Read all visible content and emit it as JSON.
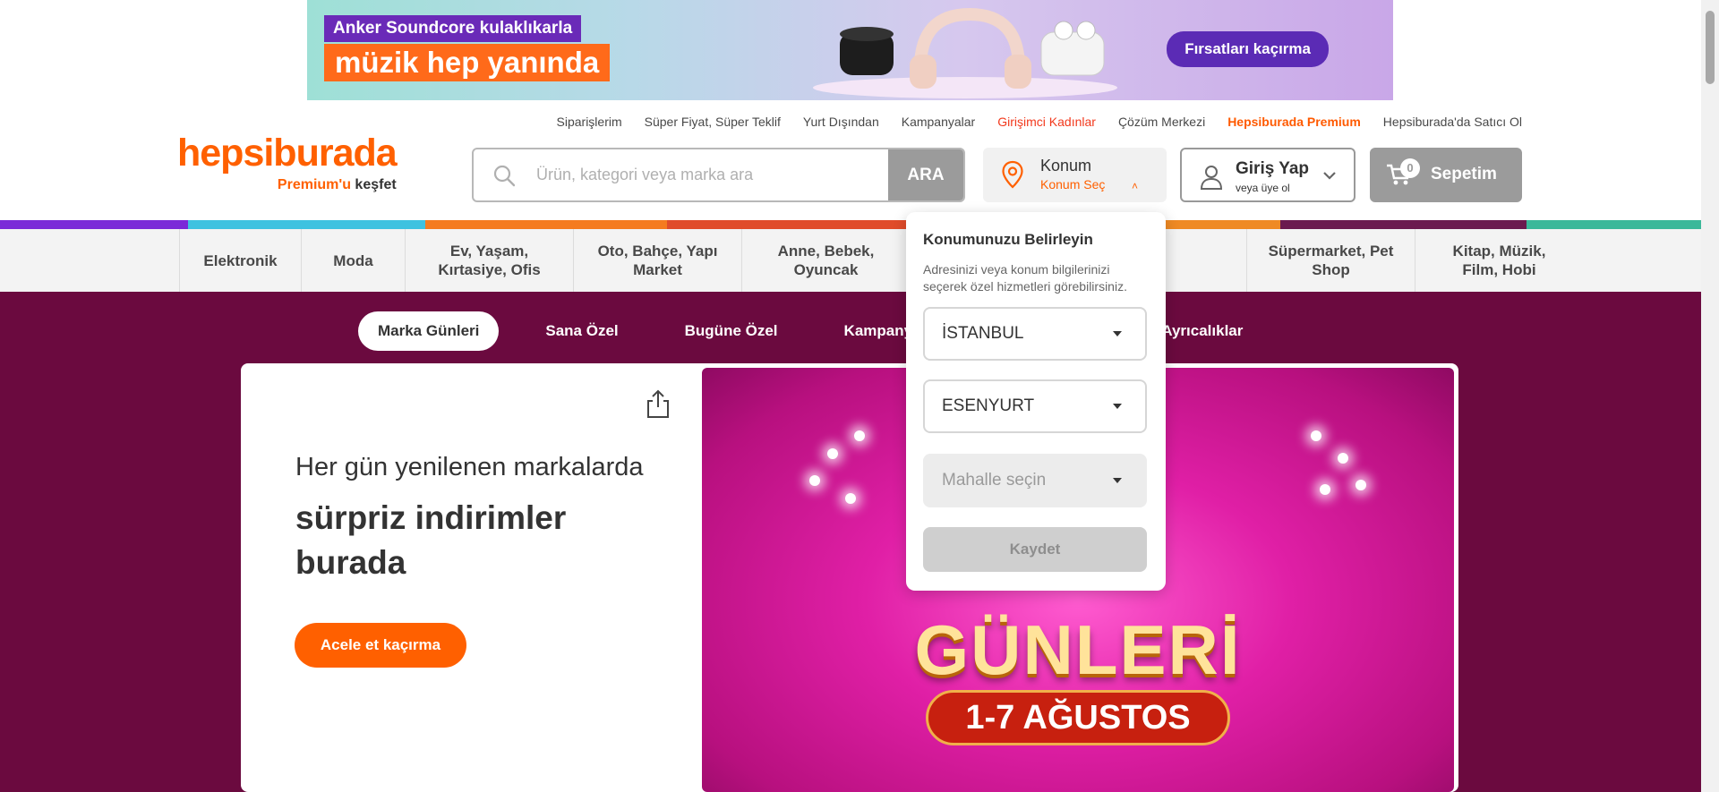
{
  "promo": {
    "line1": "Anker Soundcore kulaklıkarla",
    "line2": "müzik hep yanında",
    "cta": "Fırsatları kaçırma"
  },
  "utility_links": [
    {
      "label": "Siparişlerim",
      "style": "normal"
    },
    {
      "label": "Süper Fiyat, Süper Teklif",
      "style": "normal"
    },
    {
      "label": "Yurt Dışından",
      "style": "normal"
    },
    {
      "label": "Kampanyalar",
      "style": "normal"
    },
    {
      "label": "Girişimci Kadınlar",
      "style": "red"
    },
    {
      "label": "Çözüm Merkezi",
      "style": "normal"
    },
    {
      "label": "Hepsiburada Premium",
      "style": "orange"
    },
    {
      "label": "Hepsiburada'da Satıcı Ol",
      "style": "normal"
    }
  ],
  "logo": {
    "brand": "hepsiburada",
    "premium": "Premium'u",
    "discover": "keşfet"
  },
  "search": {
    "placeholder": "Ürün, kategori veya marka ara",
    "button": "ARA"
  },
  "location": {
    "title": "Konum",
    "subtitle": "Konum Seç",
    "chevron": "˄"
  },
  "login": {
    "title": "Giriş Yap",
    "subtitle": "veya üye ol"
  },
  "cart": {
    "count": "0",
    "label": "Sepetim"
  },
  "color_strip": [
    "#7b2ad8",
    "#3ec2e0",
    "#f57b1f",
    "#e04c2a",
    "#6b1a4f",
    "#ef8a24",
    "#6b1a4f",
    "#3bb89a"
  ],
  "categories": [
    {
      "label": "Elektronik",
      "w": 136
    },
    {
      "label": "Moda",
      "w": 116
    },
    {
      "label": "Ev, Yaşam, Kırtasiye, Ofis",
      "w": 188
    },
    {
      "label": "Oto, Bahçe, Yapı Market",
      "w": 188
    },
    {
      "label": "Anne, Bebek, Oyuncak",
      "w": 188
    },
    {
      "label": "",
      "w": 188
    },
    {
      "label": "",
      "w": 188
    },
    {
      "label": "Süpermarket, Pet Shop",
      "w": 188
    },
    {
      "label": "Kitap, Müzik, Film, Hobi",
      "w": 188
    }
  ],
  "hero_tabs": [
    "Marka Günleri",
    "Sana Özel",
    "Bugüne Özel",
    "Kampanyalar",
    "",
    "Ayrıcalıklar"
  ],
  "hero": {
    "line1": "Her gün yenilenen markalarda",
    "line2": "sürpriz indirimler burada",
    "button": "Acele et kaçırma",
    "art_title": "GÜNLERİ",
    "art_date": "1-7 AĞUSTOS"
  },
  "location_popup": {
    "title": "Konumunuzu Belirleyin",
    "description": "Adresinizi veya konum bilgilerinizi seçerek özel hizmetleri görebilirsiniz.",
    "city": "İSTANBUL",
    "district": "ESENYURT",
    "neighborhood_placeholder": "Mahalle seçin",
    "save": "Kaydet"
  }
}
